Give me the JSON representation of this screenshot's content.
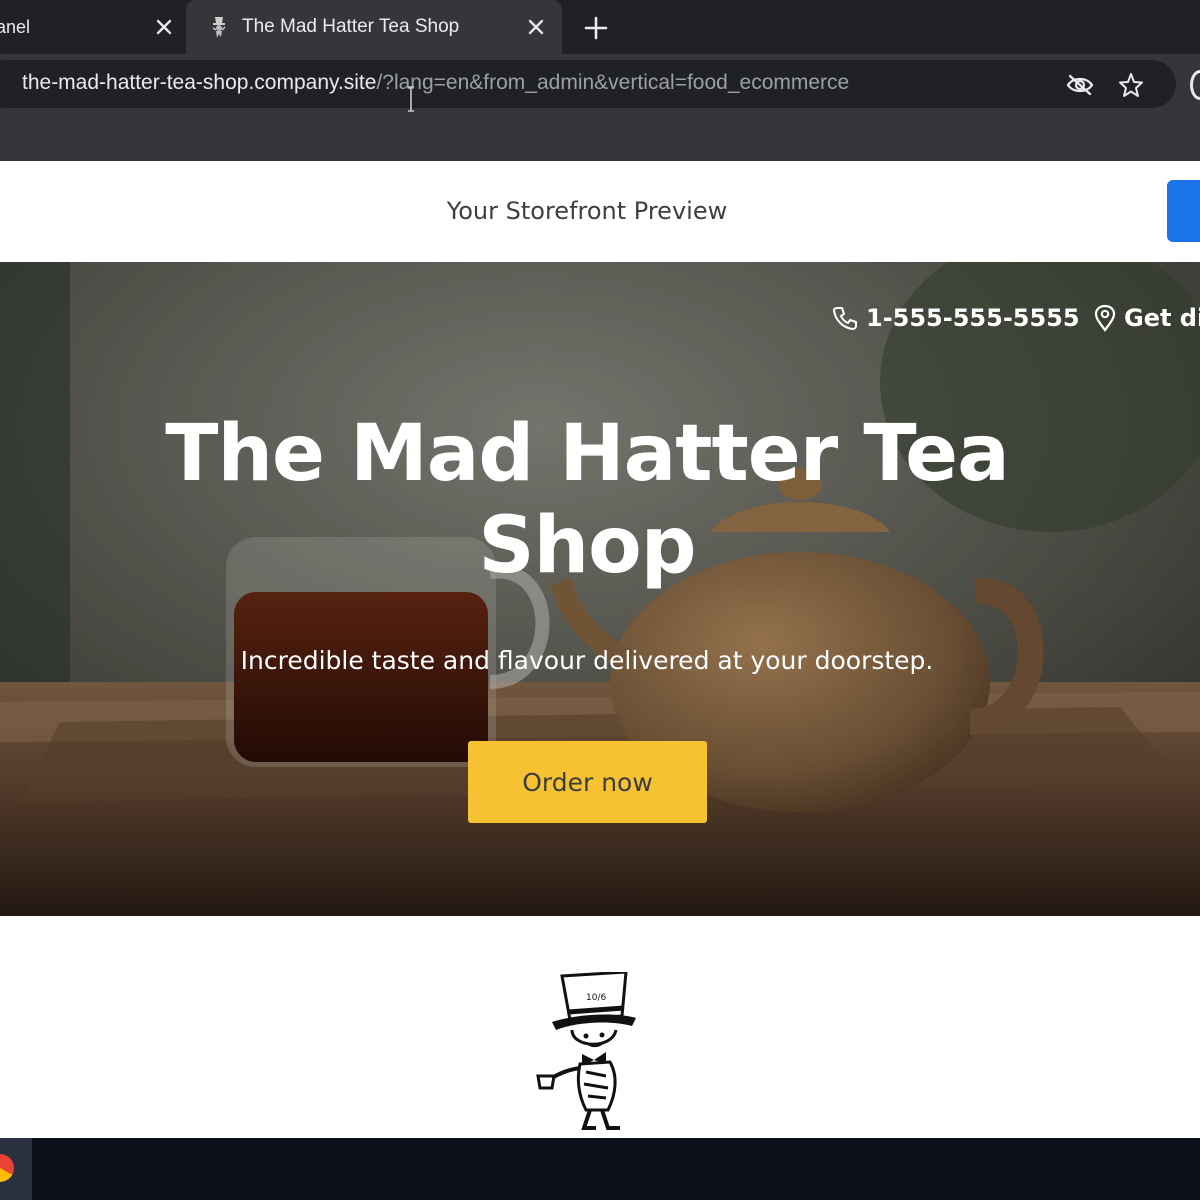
{
  "browser": {
    "tabs": [
      {
        "label": "anel",
        "active": false
      },
      {
        "label": "The Mad Hatter Tea Shop",
        "active": true,
        "favicon": "mad-hatter-favicon"
      }
    ],
    "address_bar": {
      "host": "the-mad-hatter-tea-shop.company.site",
      "path": "/?lang=en&from_admin&vertical=food_ecommerce"
    },
    "icons": [
      "close-icon",
      "plus-icon",
      "eye-off-icon",
      "star-icon"
    ]
  },
  "preview_header": {
    "title": "Your Storefront Preview",
    "button_color": "#1a73e8"
  },
  "hero": {
    "phone": "1-555-555-5555",
    "directions": "Get di",
    "title": "The Mad Hatter Tea Shop",
    "subtitle": "Incredible taste and flavour delivered at your doorstep.",
    "cta_label": "Order now",
    "cta_color": "#f6c232"
  },
  "logo": {
    "icon": "mad-hatter-logo-icon"
  },
  "taskbar": {
    "app_icon": "chrome-icon"
  }
}
